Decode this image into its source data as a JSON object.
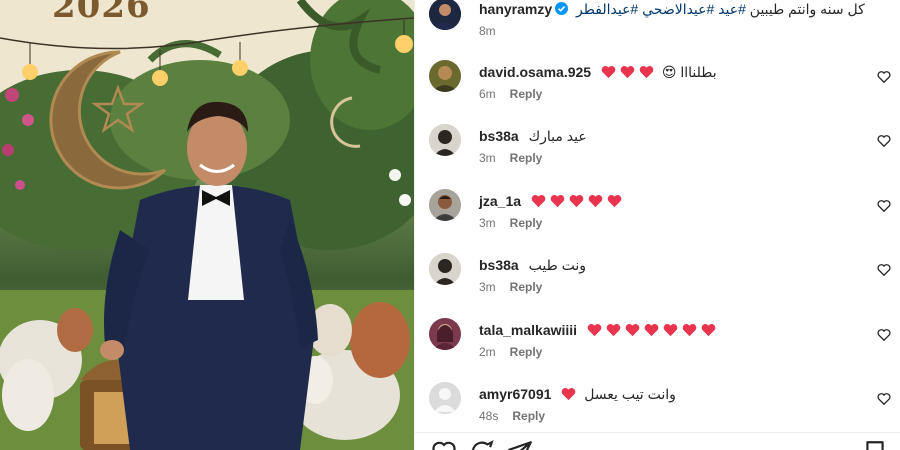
{
  "post": {
    "image_year": "2026",
    "author": "hanyramzy",
    "caption_text": "كل سنه وانتم طيبين ",
    "hashtags": [
      "#عيد",
      "#عيدالاضحي",
      "#عيدالفطر"
    ],
    "time": "8m"
  },
  "comments": [
    {
      "user": "david.osama.925",
      "text": "بطلنااا",
      "emoji_before": 3,
      "emoji_after": "😍",
      "time": "6m",
      "reply": "Reply"
    },
    {
      "user": "bs38a",
      "text": "عيد مبارك",
      "emoji_before": 0,
      "time": "3m",
      "reply": "Reply"
    },
    {
      "user": "jza_1a",
      "text": "",
      "emoji_before": 5,
      "time": "3m",
      "reply": "Reply"
    },
    {
      "user": "bs38a",
      "text": "ونت طيب",
      "emoji_before": 0,
      "time": "3m",
      "reply": "Reply"
    },
    {
      "user": "tala_malkawiiii",
      "text": "",
      "emoji_before": 7,
      "time": "2m",
      "reply": "Reply"
    },
    {
      "user": "amyr67091",
      "text": "وانت تيب يعسل",
      "emoji_before": 1,
      "time": "48s",
      "reply": "Reply"
    }
  ],
  "icons": {
    "verified": "verified-badge-icon",
    "like": "heart-outline-icon",
    "emoji": "red-heart-emoji-icon",
    "comment": "comment-bubble-icon",
    "share": "paper-plane-icon",
    "save": "bookmark-icon"
  },
  "colors": {
    "verified_blue": "#0095f6",
    "hashtag": "#00376b",
    "muted": "#737373",
    "emoji_heart": "#e8344e"
  }
}
